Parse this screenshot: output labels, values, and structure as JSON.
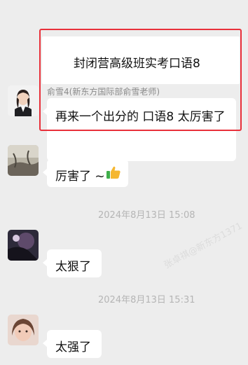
{
  "messages": [
    {
      "sender": "俞雪4(新东方国际部俞雪老师)",
      "lines": [
        "封闭营高级班实考口语8",
        "再来一个出分的 口语8  太厉害了"
      ]
    },
    {
      "sender": "",
      "text": "厉害了 ~"
    },
    {
      "timestamp": "2024年8月13日 15:08",
      "text": "太狠了"
    },
    {
      "timestamp": "2024年8月13日 15:31",
      "text": "太强了"
    }
  ],
  "watermark": {
    "text": "张卓祺@新东方1371"
  },
  "icons": {
    "emoji": "thumbs-up-emoji-icon"
  },
  "colors": {
    "background": "#ededed",
    "bubble": "#ffffff",
    "highlight": "#e8303a"
  }
}
